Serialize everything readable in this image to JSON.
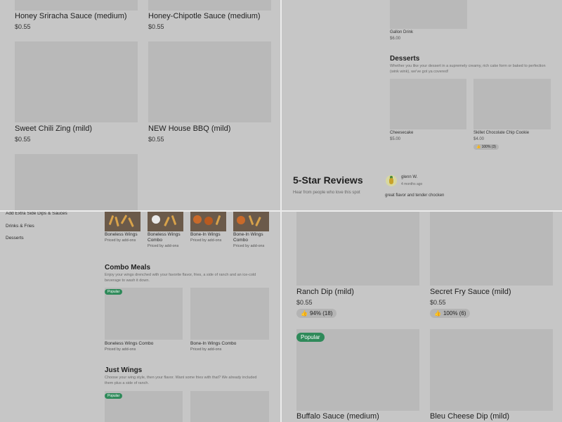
{
  "q1": {
    "items": [
      {
        "name": "Honey Sriracha Sauce (medium)",
        "price": "$0.55"
      },
      {
        "name": "Honey-Chipotle Sauce (medium)",
        "price": "$0.55"
      },
      {
        "name": "Sweet Chili Zing (mild)",
        "price": "$0.55"
      },
      {
        "name": "NEW House BBQ (mild)",
        "price": "$0.55"
      }
    ]
  },
  "q2": {
    "gallon": {
      "name": "Gallon Drink",
      "price": "$6.00"
    },
    "desserts": {
      "title": "Desserts",
      "desc": "Whether you like your dessert in a supremely creamy, rich cake form or baked to perfection (wink wink), we've got ya covered!",
      "items": [
        {
          "name": "Cheesecake",
          "price": "$5.00"
        },
        {
          "name": "Skillet Chocolate Chip Cookie",
          "price": "$4.00",
          "rating": "100% (3)"
        }
      ]
    },
    "reviews": {
      "title": "5-Star Reviews",
      "subtitle": "Hear from people who love this spot",
      "reviewer": "glenn W.",
      "time": "4 months ago",
      "text": "great flavor and tender chocken"
    }
  },
  "q3": {
    "nav": [
      "Add Extra Side Dips & Sauces",
      "Drinks & Fries",
      "Desserts"
    ],
    "top_items": [
      {
        "name": "Boneless Wings",
        "sub": "Priced by add-ons"
      },
      {
        "name": "Boneless Wings Combo",
        "sub": "Priced by add-ons"
      },
      {
        "name": "Bone-In Wings",
        "sub": "Priced by add-ons"
      },
      {
        "name": "Bone-In Wings Combo",
        "sub": "Priced by add-ons"
      }
    ],
    "combo": {
      "title": "Combo Meals",
      "desc": "Enjoy your wings drenched with your favorite flavor, fries, a side of ranch and an ice-cold beverage to wash it down.",
      "popular": "Popular",
      "items": [
        {
          "name": "Boneless Wings Combo",
          "sub": "Priced by add-ons"
        },
        {
          "name": "Bone-In Wings Combo",
          "sub": "Priced by add-ons"
        }
      ]
    },
    "just_wings": {
      "title": "Just Wings",
      "desc": "Choose your wing style, then your flavor. Want some fries with that? We already included them plus a side of ranch.",
      "popular": "Popular"
    }
  },
  "q4": {
    "items": [
      {
        "name": "Ranch Dip (mild)",
        "price": "$0.55",
        "rating": "94% (18)"
      },
      {
        "name": "Secret Fry Sauce (mild)",
        "price": "$0.55",
        "rating": "100% (6)"
      },
      {
        "name": "Buffalo Sauce (medium)",
        "popular": "Popular"
      },
      {
        "name": "Bleu Cheese Dip (mild)"
      }
    ]
  },
  "icons": {
    "thumbs_up": "👍"
  }
}
